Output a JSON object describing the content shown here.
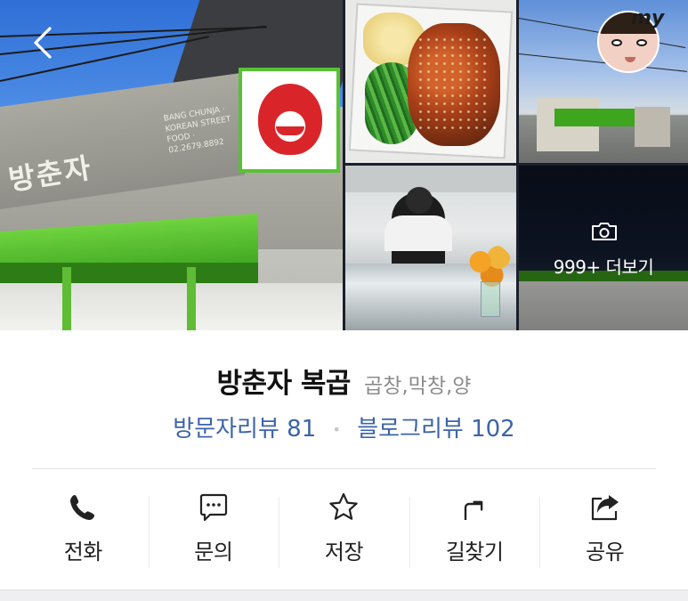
{
  "gallery": {
    "more_label": "999+ 더보기",
    "storefront_sign": "방춘자",
    "storefront_sign_sub": "BANG CHUNJA · KOREAN STREET FOOD · 02.2679.8892",
    "avatar_tag": "my"
  },
  "place": {
    "name": "방춘자 복곱",
    "category": "곱창,막창,양",
    "visitor_review_label": "방문자리뷰 81",
    "blog_review_label": "블로그리뷰 102",
    "separator": "•"
  },
  "actions": [
    {
      "label": "전화",
      "icon": "phone-icon"
    },
    {
      "label": "문의",
      "icon": "chat-bubble-icon"
    },
    {
      "label": "저장",
      "icon": "star-icon"
    },
    {
      "label": "길찾기",
      "icon": "directions-icon"
    },
    {
      "label": "공유",
      "icon": "share-icon"
    }
  ],
  "colors": {
    "review_link": "#3c64a8",
    "brand_green": "#58c235",
    "divider": "#e3e3e3"
  }
}
